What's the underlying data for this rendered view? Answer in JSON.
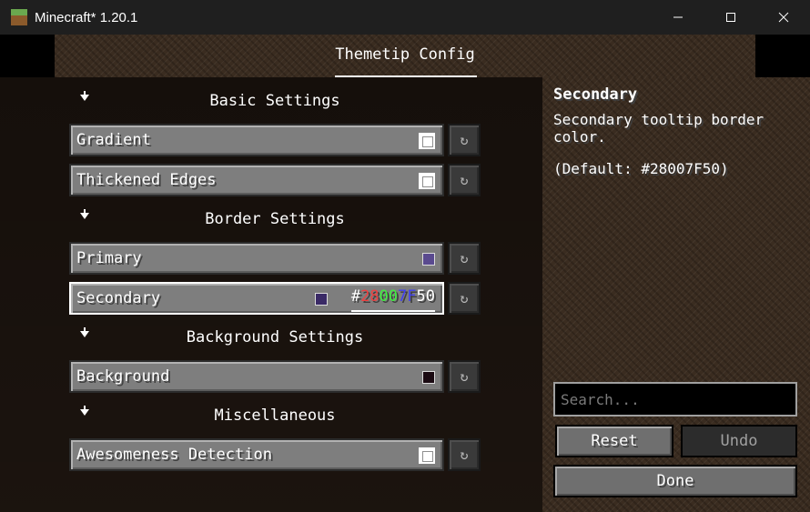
{
  "window": {
    "title": "Minecraft* 1.20.1",
    "minimize_icon": "minimize-icon",
    "maximize_icon": "maximize-icon",
    "close_icon": "close-icon"
  },
  "header": {
    "title": "Themetip Config"
  },
  "sections": {
    "basic": {
      "label": "Basic Settings"
    },
    "border": {
      "label": "Border Settings"
    },
    "background": {
      "label": "Background Settings"
    },
    "misc": {
      "label": "Miscellaneous"
    }
  },
  "entries": {
    "gradient": {
      "label": "Gradient",
      "checked": true
    },
    "thickened_edges": {
      "label": "Thickened Edges",
      "checked": true
    },
    "primary": {
      "label": "Primary",
      "swatch_color": "#5a4a8f"
    },
    "secondary": {
      "label": "Secondary",
      "swatch_color": "#3a2a66",
      "hex_prefix": "#",
      "hex_a": "28",
      "hex_r": "00",
      "hex_g": "7F",
      "hex_b": "50"
    },
    "background": {
      "label": "Background",
      "swatch_color": "#1a0a12"
    },
    "awesomeness": {
      "label": "Awesomeness Detection",
      "checked": true
    }
  },
  "reset_icon": "reset-icon",
  "description": {
    "title": "Secondary",
    "text": "Secondary tooltip border color.",
    "default": "(Default: #28007F50)"
  },
  "search": {
    "placeholder": "Search..."
  },
  "buttons": {
    "reset": "Reset",
    "undo": "Undo",
    "done": "Done"
  }
}
